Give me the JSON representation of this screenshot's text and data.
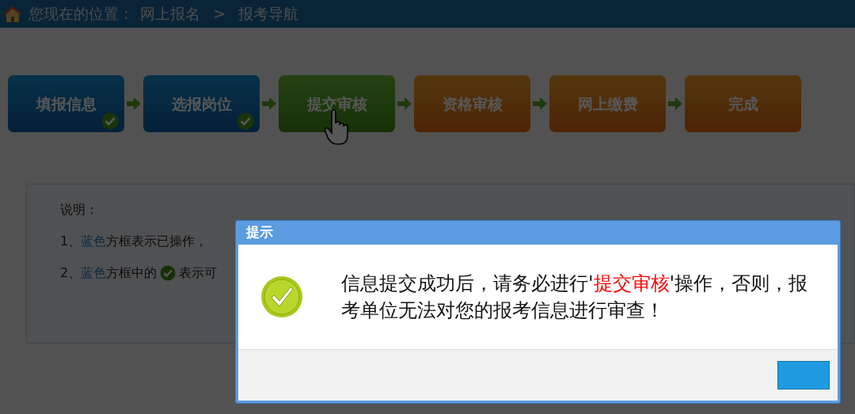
{
  "breadcrumb": {
    "label": "您现在的位置：",
    "items": [
      {
        "text": "网上报名"
      },
      {
        "text": "报考导航"
      }
    ],
    "separator": ">"
  },
  "steps": [
    {
      "label": "填报信息",
      "kind": "done"
    },
    {
      "label": "选报岗位",
      "kind": "done"
    },
    {
      "label": "提交审核",
      "kind": "current"
    },
    {
      "label": "资格审核",
      "kind": "pending"
    },
    {
      "label": "网上缴费",
      "kind": "pending"
    },
    {
      "label": "完成",
      "kind": "pending"
    }
  ],
  "notes": {
    "title": "说明：",
    "lines": [
      {
        "segments": [
          {
            "kind": "text",
            "text": "1、"
          },
          {
            "kind": "highlight",
            "text": "蓝色"
          },
          {
            "kind": "text",
            "text": "方框表示已操作，"
          }
        ]
      },
      {
        "segments": [
          {
            "kind": "text",
            "text": "2、"
          },
          {
            "kind": "highlight",
            "text": "蓝色"
          },
          {
            "kind": "text",
            "text": "方框中的"
          },
          {
            "kind": "check"
          },
          {
            "kind": "text",
            "text": "表示可"
          }
        ]
      }
    ]
  },
  "dialog": {
    "title": "提示",
    "message": [
      {
        "text": "信息提交成功后，请务必进行'"
      },
      {
        "text": "提交审核",
        "color": "#ff0000"
      },
      {
        "text": "'操作，否则，报考单位无法对您的报考信息进行审查！"
      }
    ]
  }
}
